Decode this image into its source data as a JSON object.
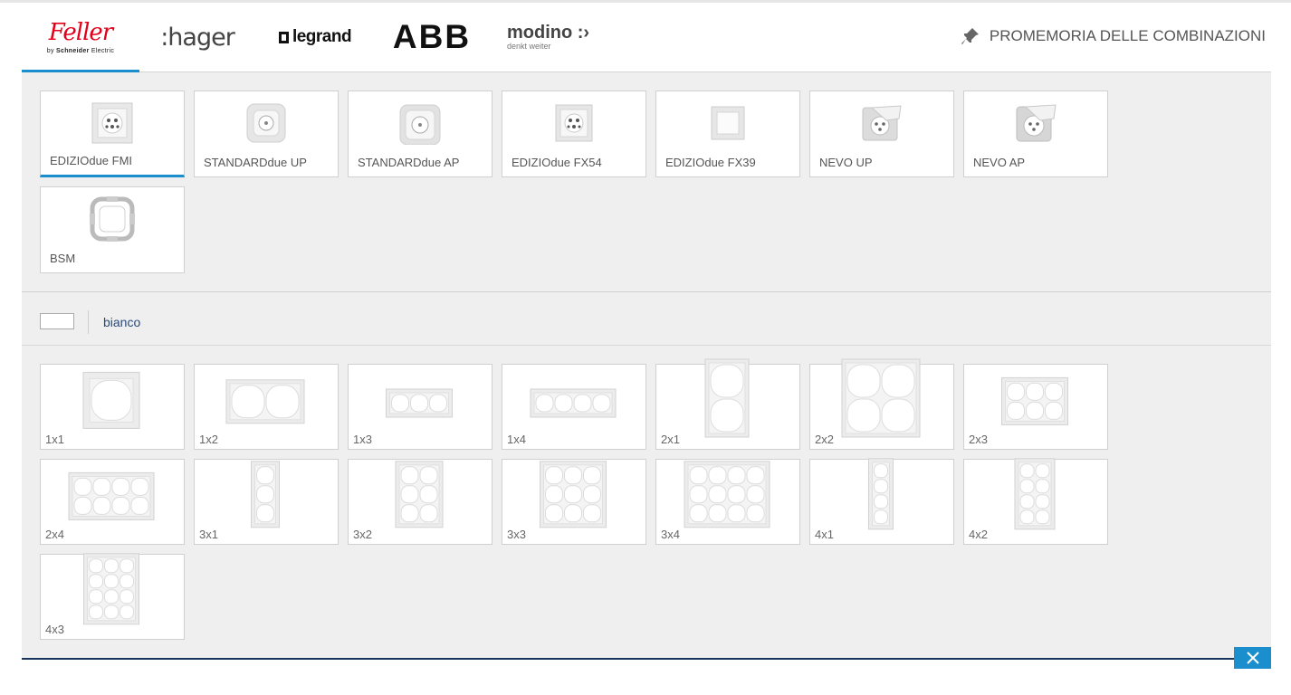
{
  "brands": {
    "feller": {
      "script": "Feller",
      "by_prefix": "by ",
      "by_bold": "Schneider",
      "by_suffix": " Electric"
    },
    "hager": ":hager",
    "legrand": "legrand",
    "abb": "ABB",
    "modino": {
      "name": "modino",
      "tagline": "denkt weiter"
    }
  },
  "reminder_label": "PROMEMORIA DELLE COMBINAZIONI",
  "products": [
    {
      "label": "EDIZIOdue FMI",
      "selected": true
    },
    {
      "label": "STANDARDdue UP",
      "selected": false
    },
    {
      "label": "STANDARDdue AP",
      "selected": false
    },
    {
      "label": "EDIZIOdue FX54",
      "selected": false
    },
    {
      "label": "EDIZIOdue FX39",
      "selected": false
    },
    {
      "label": "NEVO UP",
      "selected": false
    },
    {
      "label": "NEVO AP",
      "selected": false
    },
    {
      "label": "BSM",
      "selected": false
    }
  ],
  "color": {
    "name": "bianco",
    "swatch": "#ffffff"
  },
  "frames": [
    "1x1",
    "1x2",
    "1x3",
    "1x4",
    "2x1",
    "2x2",
    "2x3",
    "2x4",
    "3x1",
    "3x2",
    "3x3",
    "3x4",
    "4x1",
    "4x2",
    "4x3"
  ],
  "colors": {
    "accent": "#1b8fce",
    "navy": "#19365f",
    "background": "#efefef"
  }
}
